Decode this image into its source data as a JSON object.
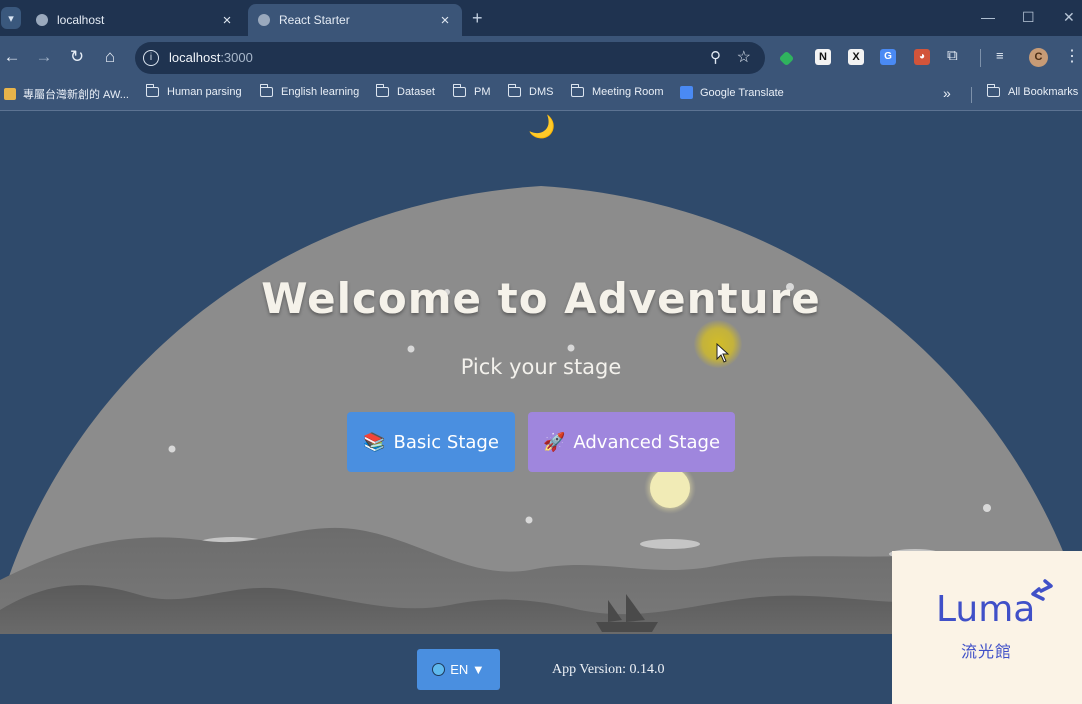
{
  "browser": {
    "tabs": [
      {
        "title": "localhost",
        "active": false
      },
      {
        "title": "React Starter",
        "active": true
      }
    ],
    "new_tab_symbol": "+",
    "window_controls": [
      "—",
      "☐",
      "✕"
    ],
    "address": {
      "host": "localhost",
      "port": ":3000"
    },
    "toolbar_icons": [
      "back-icon",
      "forward-icon",
      "reload-icon",
      "home-icon",
      "site-info-icon",
      "zoom-icon",
      "bookmark-star-icon"
    ],
    "extensions": [
      "green-extension-icon",
      "notion-icon",
      "x-icon",
      "translate-icon",
      "red-panda-icon",
      "puzzle-icon",
      "media-icon"
    ],
    "avatar_letter": "C",
    "bookmarks": [
      {
        "label": "專屬台灣新創的 AW...",
        "icon": "box-icon"
      },
      {
        "label": "Human parsing",
        "icon": "folder-icon"
      },
      {
        "label": "English learning",
        "icon": "folder-icon"
      },
      {
        "label": "Dataset",
        "icon": "folder-icon"
      },
      {
        "label": "PM",
        "icon": "folder-icon"
      },
      {
        "label": "DMS",
        "icon": "folder-icon"
      },
      {
        "label": "Meeting Room",
        "icon": "folder-icon"
      },
      {
        "label": "Google Translate",
        "icon": "google-translate-icon"
      }
    ],
    "bookmarks_overflow": "»",
    "all_bookmarks": "All Bookmarks"
  },
  "app": {
    "moon_icon": "🌙",
    "title": "Welcome to Adventure",
    "subtitle": "Pick your stage",
    "buttons": [
      {
        "icon": "📚",
        "label": "Basic Stage",
        "color": "#4a8fe0"
      },
      {
        "icon": "🚀",
        "label": "Advanced Stage",
        "color": "#9f86dd"
      }
    ],
    "language": {
      "label": "EN ▼"
    },
    "version": "App Version: 0.14.0"
  },
  "watermark": {
    "brand": "Luma",
    "sub": "流光館"
  },
  "colors": {
    "page_bg": "#2f4a6b",
    "browser_frame": "#1f3350",
    "toolbar": "#3b5578",
    "hill": "#8c8c8c",
    "accent_blue": "#4a8fe0",
    "accent_purple": "#9f86dd",
    "cursor_highlight": "#d6bf22"
  }
}
